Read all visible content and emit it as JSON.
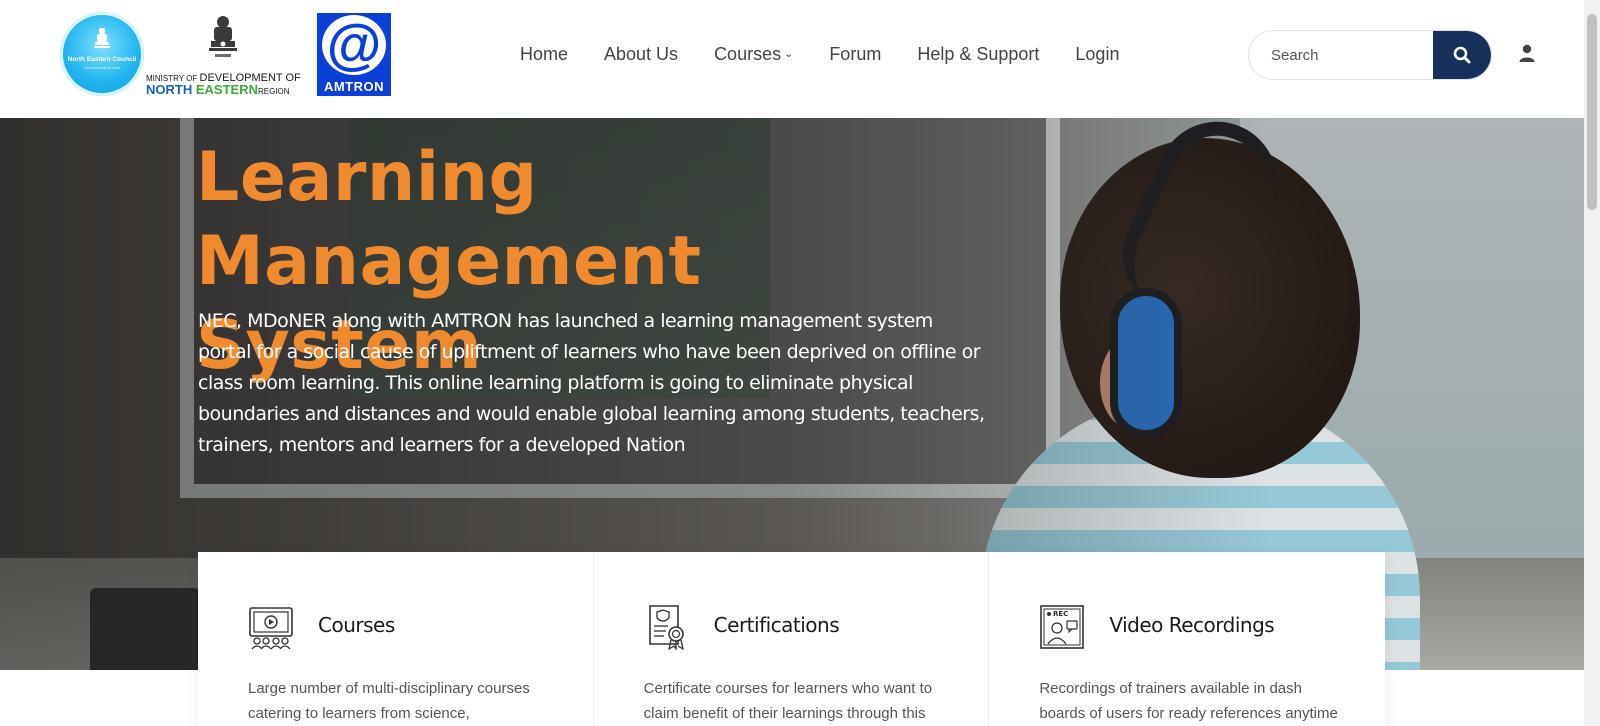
{
  "logos": {
    "nec_name": "North Eastern Council",
    "nec_sub": "Government of India",
    "mdoner_line1_small": "MINISTRY OF ",
    "mdoner_line1_big": "DEVELOPMENT OF",
    "mdoner_line2_a": "NORTH ",
    "mdoner_line2_b": "EASTERN",
    "mdoner_line2_c": "REGION",
    "amtron_symbol": "@",
    "amtron_label": "AMTRON"
  },
  "nav": {
    "items": [
      {
        "label": "Home"
      },
      {
        "label": "About Us"
      },
      {
        "label": "Courses",
        "has_dropdown": true
      },
      {
        "label": "Forum"
      },
      {
        "label": "Help & Support"
      },
      {
        "label": "Login"
      }
    ]
  },
  "search": {
    "placeholder": "Search",
    "value": "",
    "button_icon": "search-icon",
    "button_color": "#17305b"
  },
  "user": {
    "icon": "user-icon"
  },
  "hero": {
    "title_line1": "Learning",
    "title_line2": "Management System",
    "title_color": "#f08a2f",
    "description": "NEC, MDoNER along with AMTRON has launched a learning management system portal for a social cause of upliftment of learners who have been deprived on offline or class room learning. This online learning platform is going to eliminate physical boundaries and distances and would enable global learning among students, teachers, trainers, mentors and learners for a developed Nation"
  },
  "features": [
    {
      "icon": "courses-icon",
      "title": "Courses",
      "description": "Large number of multi-disciplinary courses catering to learners from science,"
    },
    {
      "icon": "certificate-icon",
      "title": "Certifications",
      "description": "Certificate courses for learners who want to claim benefit of their learnings through this"
    },
    {
      "icon": "video-recording-icon",
      "title": "Video Recordings",
      "description": "Recordings of trainers available in dash boards of users for ready references anytime"
    }
  ]
}
